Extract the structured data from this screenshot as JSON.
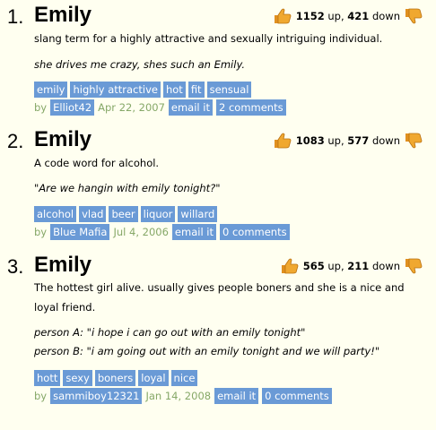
{
  "entries": [
    {
      "number": "1.",
      "word": "Emily",
      "up": "1152",
      "up_label": "up,",
      "down": "421",
      "down_label": "down",
      "definition": "slang term for a highly attractive and sexually intriguing individual.",
      "example_lines": [
        "she drives me crazy, shes such an Emily."
      ],
      "tags": [
        "emily",
        "highly attractive",
        "hot",
        "fit",
        "sensual"
      ],
      "by": "by",
      "author": "Elliot42",
      "date": "Apr 22, 2007",
      "email": "email it",
      "comments": "2 comments"
    },
    {
      "number": "2.",
      "word": "Emily",
      "up": "1083",
      "up_label": "up,",
      "down": "577",
      "down_label": "down",
      "definition": "A code word for alcohol.",
      "example_lines": [
        "\"Are we hangin with emily tonight?\""
      ],
      "tags": [
        "alcohol",
        "vlad",
        "beer",
        "liquor",
        "willard"
      ],
      "by": "by",
      "author": "Blue Mafia",
      "date": "Jul 4, 2006",
      "email": "email it",
      "comments": "0 comments"
    },
    {
      "number": "3.",
      "word": "Emily",
      "up": "565",
      "up_label": "up,",
      "down": "211",
      "down_label": "down",
      "definition": "The hottest girl alive. usually gives people boners and she is a nice and loyal friend.",
      "example_lines": [
        "person A: \"i hope i can go out with an emily tonight\"",
        "person B: \"i am going out with an emily tonight and we will party!\""
      ],
      "tags": [
        "hott",
        "sexy",
        "boners",
        "loyal",
        "nice"
      ],
      "by": "by",
      "author": "sammiboy12321",
      "date": "Jan 14, 2008",
      "email": "email it",
      "comments": "0 comments"
    }
  ],
  "colors": {
    "background": "#fffff0",
    "tag_bg": "#6a9ad6",
    "date_text": "#86a868",
    "thumb": "#f0a830"
  },
  "icons": {
    "up": "thumbs-up-icon",
    "down": "thumbs-down-icon"
  }
}
